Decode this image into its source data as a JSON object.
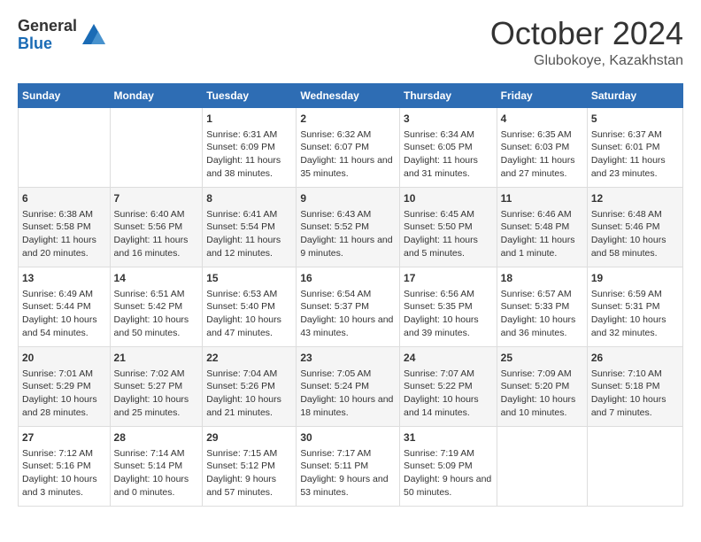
{
  "logo": {
    "general": "General",
    "blue": "Blue"
  },
  "header": {
    "month": "October 2024",
    "location": "Glubokoye, Kazakhstan"
  },
  "weekdays": [
    "Sunday",
    "Monday",
    "Tuesday",
    "Wednesday",
    "Thursday",
    "Friday",
    "Saturday"
  ],
  "weeks": [
    [
      {
        "day": "",
        "info": ""
      },
      {
        "day": "",
        "info": ""
      },
      {
        "day": "1",
        "info": "Sunrise: 6:31 AM\nSunset: 6:09 PM\nDaylight: 11 hours and 38 minutes."
      },
      {
        "day": "2",
        "info": "Sunrise: 6:32 AM\nSunset: 6:07 PM\nDaylight: 11 hours and 35 minutes."
      },
      {
        "day": "3",
        "info": "Sunrise: 6:34 AM\nSunset: 6:05 PM\nDaylight: 11 hours and 31 minutes."
      },
      {
        "day": "4",
        "info": "Sunrise: 6:35 AM\nSunset: 6:03 PM\nDaylight: 11 hours and 27 minutes."
      },
      {
        "day": "5",
        "info": "Sunrise: 6:37 AM\nSunset: 6:01 PM\nDaylight: 11 hours and 23 minutes."
      }
    ],
    [
      {
        "day": "6",
        "info": "Sunrise: 6:38 AM\nSunset: 5:58 PM\nDaylight: 11 hours and 20 minutes."
      },
      {
        "day": "7",
        "info": "Sunrise: 6:40 AM\nSunset: 5:56 PM\nDaylight: 11 hours and 16 minutes."
      },
      {
        "day": "8",
        "info": "Sunrise: 6:41 AM\nSunset: 5:54 PM\nDaylight: 11 hours and 12 minutes."
      },
      {
        "day": "9",
        "info": "Sunrise: 6:43 AM\nSunset: 5:52 PM\nDaylight: 11 hours and 9 minutes."
      },
      {
        "day": "10",
        "info": "Sunrise: 6:45 AM\nSunset: 5:50 PM\nDaylight: 11 hours and 5 minutes."
      },
      {
        "day": "11",
        "info": "Sunrise: 6:46 AM\nSunset: 5:48 PM\nDaylight: 11 hours and 1 minute."
      },
      {
        "day": "12",
        "info": "Sunrise: 6:48 AM\nSunset: 5:46 PM\nDaylight: 10 hours and 58 minutes."
      }
    ],
    [
      {
        "day": "13",
        "info": "Sunrise: 6:49 AM\nSunset: 5:44 PM\nDaylight: 10 hours and 54 minutes."
      },
      {
        "day": "14",
        "info": "Sunrise: 6:51 AM\nSunset: 5:42 PM\nDaylight: 10 hours and 50 minutes."
      },
      {
        "day": "15",
        "info": "Sunrise: 6:53 AM\nSunset: 5:40 PM\nDaylight: 10 hours and 47 minutes."
      },
      {
        "day": "16",
        "info": "Sunrise: 6:54 AM\nSunset: 5:37 PM\nDaylight: 10 hours and 43 minutes."
      },
      {
        "day": "17",
        "info": "Sunrise: 6:56 AM\nSunset: 5:35 PM\nDaylight: 10 hours and 39 minutes."
      },
      {
        "day": "18",
        "info": "Sunrise: 6:57 AM\nSunset: 5:33 PM\nDaylight: 10 hours and 36 minutes."
      },
      {
        "day": "19",
        "info": "Sunrise: 6:59 AM\nSunset: 5:31 PM\nDaylight: 10 hours and 32 minutes."
      }
    ],
    [
      {
        "day": "20",
        "info": "Sunrise: 7:01 AM\nSunset: 5:29 PM\nDaylight: 10 hours and 28 minutes."
      },
      {
        "day": "21",
        "info": "Sunrise: 7:02 AM\nSunset: 5:27 PM\nDaylight: 10 hours and 25 minutes."
      },
      {
        "day": "22",
        "info": "Sunrise: 7:04 AM\nSunset: 5:26 PM\nDaylight: 10 hours and 21 minutes."
      },
      {
        "day": "23",
        "info": "Sunrise: 7:05 AM\nSunset: 5:24 PM\nDaylight: 10 hours and 18 minutes."
      },
      {
        "day": "24",
        "info": "Sunrise: 7:07 AM\nSunset: 5:22 PM\nDaylight: 10 hours and 14 minutes."
      },
      {
        "day": "25",
        "info": "Sunrise: 7:09 AM\nSunset: 5:20 PM\nDaylight: 10 hours and 10 minutes."
      },
      {
        "day": "26",
        "info": "Sunrise: 7:10 AM\nSunset: 5:18 PM\nDaylight: 10 hours and 7 minutes."
      }
    ],
    [
      {
        "day": "27",
        "info": "Sunrise: 7:12 AM\nSunset: 5:16 PM\nDaylight: 10 hours and 3 minutes."
      },
      {
        "day": "28",
        "info": "Sunrise: 7:14 AM\nSunset: 5:14 PM\nDaylight: 10 hours and 0 minutes."
      },
      {
        "day": "29",
        "info": "Sunrise: 7:15 AM\nSunset: 5:12 PM\nDaylight: 9 hours and 57 minutes."
      },
      {
        "day": "30",
        "info": "Sunrise: 7:17 AM\nSunset: 5:11 PM\nDaylight: 9 hours and 53 minutes."
      },
      {
        "day": "31",
        "info": "Sunrise: 7:19 AM\nSunset: 5:09 PM\nDaylight: 9 hours and 50 minutes."
      },
      {
        "day": "",
        "info": ""
      },
      {
        "day": "",
        "info": ""
      }
    ]
  ]
}
